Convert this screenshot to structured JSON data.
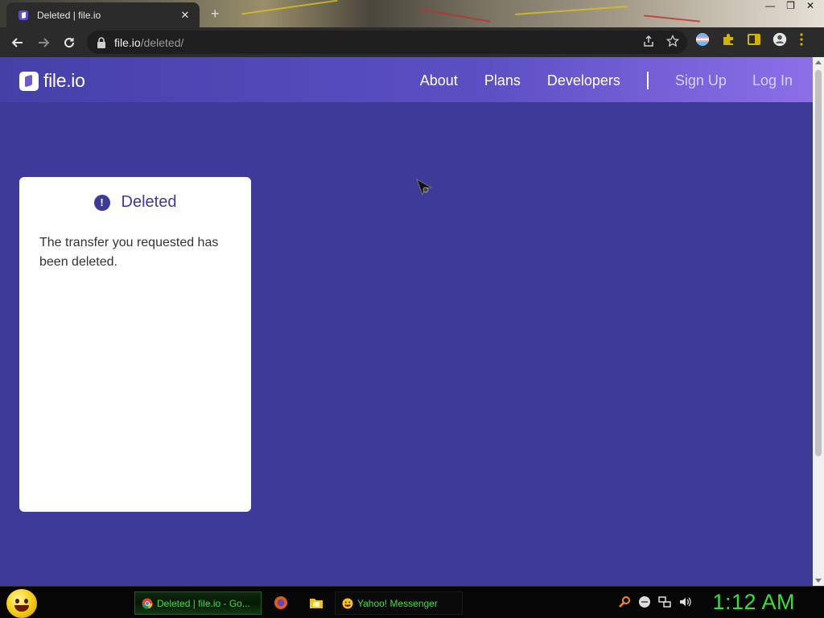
{
  "browser": {
    "tab_title": "Deleted | file.io",
    "new_tab_symbol": "+",
    "url_host": "file.io",
    "url_path": "/deleted/"
  },
  "site": {
    "logo_text": "file.io",
    "nav": {
      "about": "About",
      "plans": "Plans",
      "developers": "Developers",
      "sign_up": "Sign Up",
      "log_in": "Log In"
    }
  },
  "card": {
    "title": "Deleted",
    "alert_symbol": "!",
    "message": "The transfer you requested has been deleted."
  },
  "taskbar": {
    "items": [
      {
        "label": "Deleted | file.io - Go...",
        "icon": "chrome-icon"
      },
      {
        "label": "Yahoo! Messenger",
        "icon": "yahoo-messenger-icon"
      }
    ],
    "clock": "1:12 AM"
  },
  "colors": {
    "page_background": "#3d3a9a",
    "header_gradient_start": "#4540a8",
    "header_gradient_end": "#8b6fe8",
    "card_title": "#3d3a9a",
    "taskbar_text": "#3fe03f"
  }
}
